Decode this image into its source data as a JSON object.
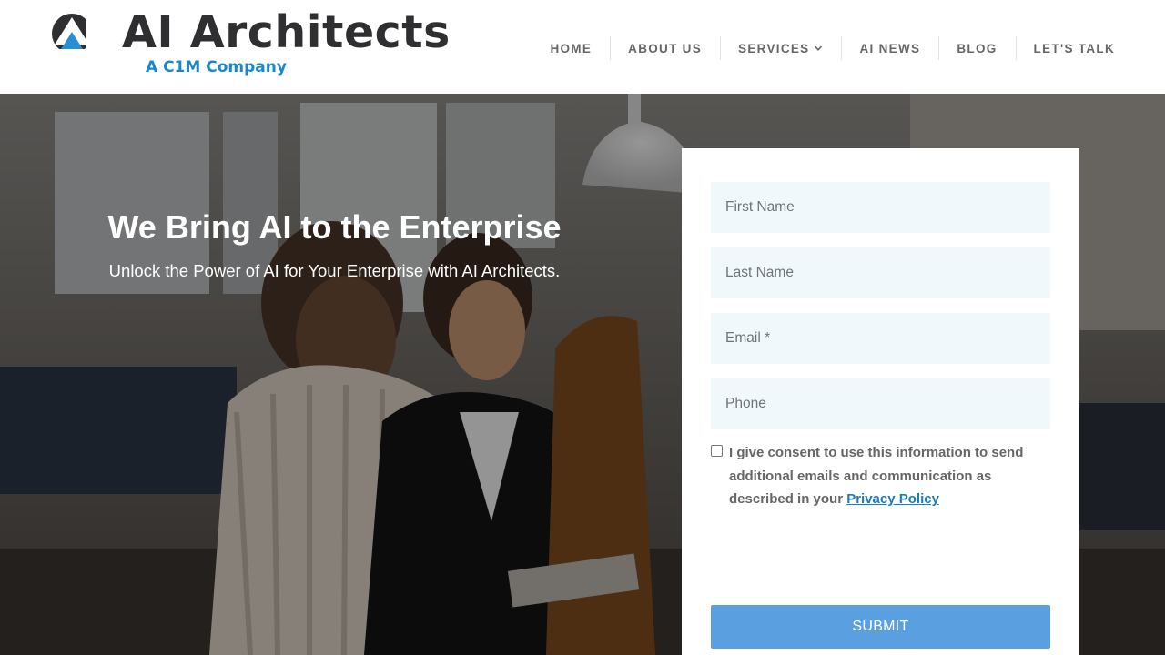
{
  "brand": {
    "name": "AI Architects",
    "tagline": "A C1M Company",
    "colors": {
      "dark": "#2f2f31",
      "accent": "#1a87c9"
    }
  },
  "nav": {
    "items": [
      {
        "label": "HOME"
      },
      {
        "label": "ABOUT US"
      },
      {
        "label": "SERVICES",
        "dropdown": true
      },
      {
        "label": "AI NEWS"
      },
      {
        "label": "BLOG"
      },
      {
        "label": "LET'S TALK"
      }
    ]
  },
  "hero": {
    "title": "We Bring AI to the Enterprise",
    "subtitle": "Unlock the Power of AI for Your Enterprise with AI Architects."
  },
  "form": {
    "first_name_placeholder": "First Name",
    "last_name_placeholder": "Last Name",
    "email_placeholder": "Email *",
    "phone_placeholder": "Phone",
    "consent_text": "I give consent to use this information to send additional emails and communication as described in your ",
    "consent_link": "Privacy Policy",
    "consent_checked": false,
    "submit_label": "SUBMIT",
    "colors": {
      "field_bg": "#f1f8fc",
      "submit_bg": "#5aa0e0",
      "link": "#1a7bbf"
    }
  }
}
